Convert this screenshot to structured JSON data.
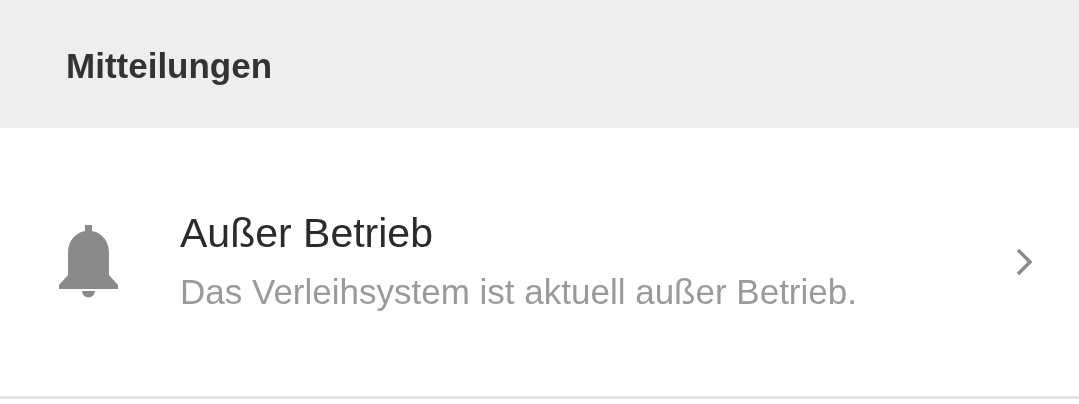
{
  "section": {
    "title": "Mitteilungen"
  },
  "notifications": [
    {
      "title": "Außer Betrieb",
      "message": "Das Verleihsystem ist aktuell außer Betrieb."
    }
  ]
}
